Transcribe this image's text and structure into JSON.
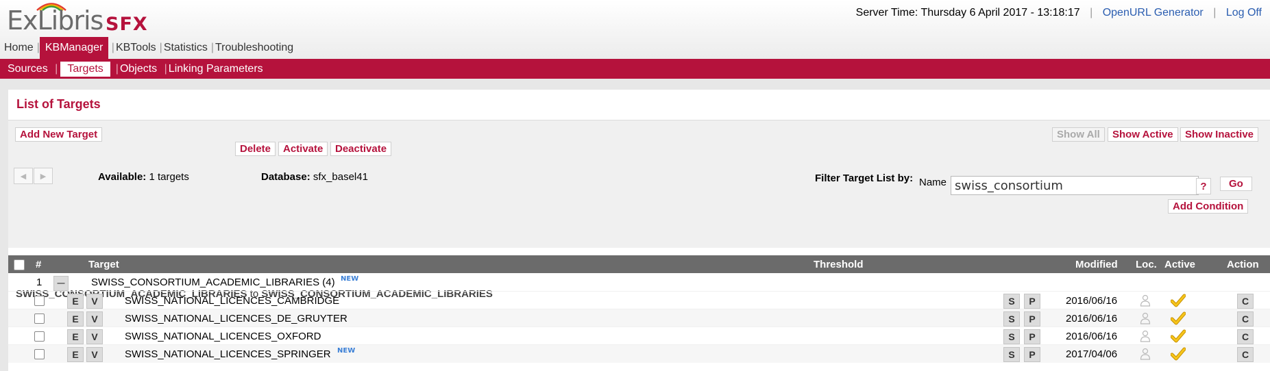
{
  "logo": {
    "brand": "ExLibris",
    "product": "SFX"
  },
  "server": {
    "time_text": "Server Time: Thursday 6 April 2017 - 13:18:17",
    "openurl_label": "OpenURL Generator",
    "logoff_label": "Log Off"
  },
  "main_nav": [
    "Home",
    "KBManager",
    "KBTools",
    "Statistics",
    "Troubleshooting"
  ],
  "sub_nav": [
    "Sources",
    "Targets",
    "Objects",
    "Linking Parameters"
  ],
  "page_title": "List of Targets",
  "buttons": {
    "add_new_target": "Add New Target",
    "delete": "Delete",
    "activate": "Activate",
    "deactivate": "Deactivate",
    "show_all": "Show All",
    "show_active": "Show Active",
    "show_inactive": "Show Inactive",
    "go": "Go",
    "add_condition": "Add Condition",
    "help": "?"
  },
  "info": {
    "available_label": "Available:",
    "available_value": "1 targets",
    "database_label": "Database:",
    "database_value": "sfx_basel41",
    "filter_label": "Filter Target List by:",
    "filter_field": "Name",
    "filter_value": "swiss_consortium"
  },
  "range": {
    "from": "SWISS_CONSORTIUM_ACADEMIC_LIBRARIES",
    "to_word": "to",
    "to": "SWISS_CONSORTIUM_ACADEMIC_LIBRARIES"
  },
  "table": {
    "headers": {
      "num": "#",
      "target": "Target",
      "threshold": "Threshold",
      "modified": "Modified",
      "loc": "Loc.",
      "active": "Active",
      "action": "Action"
    },
    "group": {
      "num": "1",
      "toggle": "—",
      "name": "SWISS_CONSORTIUM_ACADEMIC_LIBRARIES (4)",
      "badge": "NEW"
    },
    "button_labels": {
      "e": "E",
      "v": "V",
      "s": "S",
      "p": "P",
      "c": "C"
    },
    "rows": [
      {
        "name": "SWISS_NATIONAL_LICENCES_CAMBRIDGE",
        "modified": "2016/06/16",
        "badge": ""
      },
      {
        "name": "SWISS_NATIONAL_LICENCES_DE_GRUYTER",
        "modified": "2016/06/16",
        "badge": ""
      },
      {
        "name": "SWISS_NATIONAL_LICENCES_OXFORD",
        "modified": "2016/06/16",
        "badge": ""
      },
      {
        "name": "SWISS_NATIONAL_LICENCES_SPRINGER",
        "modified": "2017/04/06",
        "badge": "NEW"
      }
    ]
  },
  "colors": {
    "brand_red": "#b5123c",
    "header_gray": "#6b6b6b",
    "link_blue": "#2a5db0",
    "active_check": "#e8b400"
  },
  "icons": [
    "arrow-left-icon",
    "arrow-right-icon",
    "person-icon",
    "checkmark-icon",
    "collapse-icon"
  ]
}
